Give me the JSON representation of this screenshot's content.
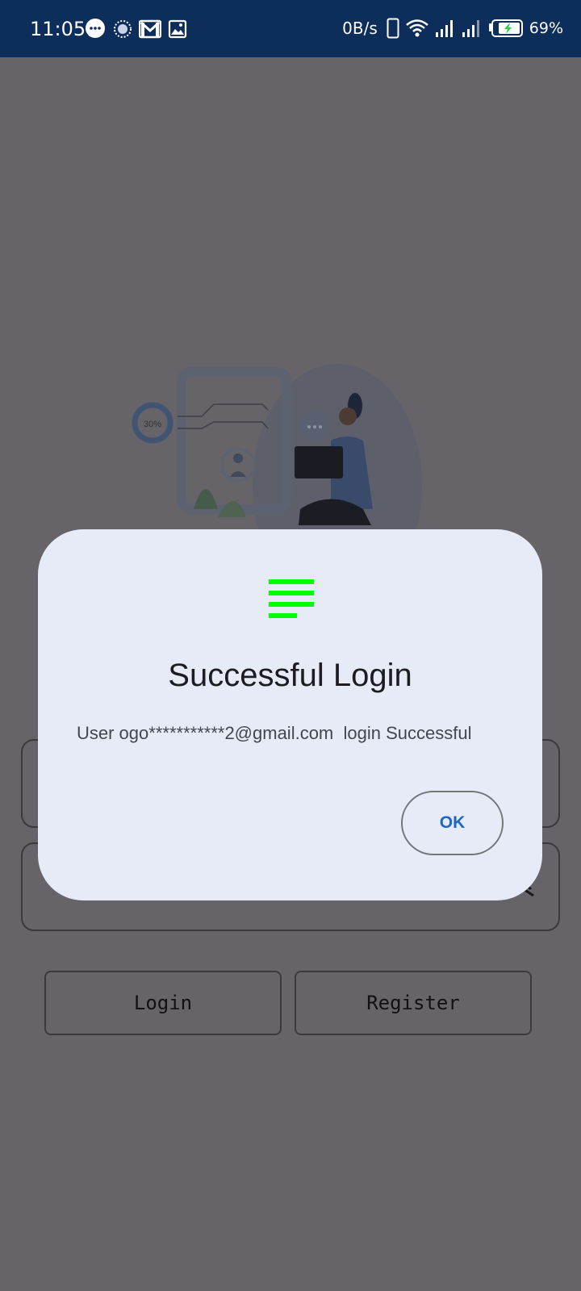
{
  "status_bar": {
    "time": "11:05",
    "network_speed": "0B/s",
    "battery_percent": "69%",
    "icons": [
      "messages-icon",
      "sync-icon",
      "gmail-icon",
      "gallery-icon",
      "phone-icon",
      "wifi-icon",
      "signal-icon",
      "signal-icon-2",
      "battery-charging-icon"
    ],
    "background_color": "#0d2e5a"
  },
  "illustration": {
    "progress_ring_label": "30%"
  },
  "buttons": {
    "login_label": "Login",
    "register_label": "Register"
  },
  "dialog": {
    "icon": "menu-lines-icon",
    "icon_color": "#00ff00",
    "title": "Successful Login",
    "message": "User ogo***********2@gmail.com  login Successful",
    "ok_label": "OK",
    "ok_color": "#1e67c6"
  }
}
